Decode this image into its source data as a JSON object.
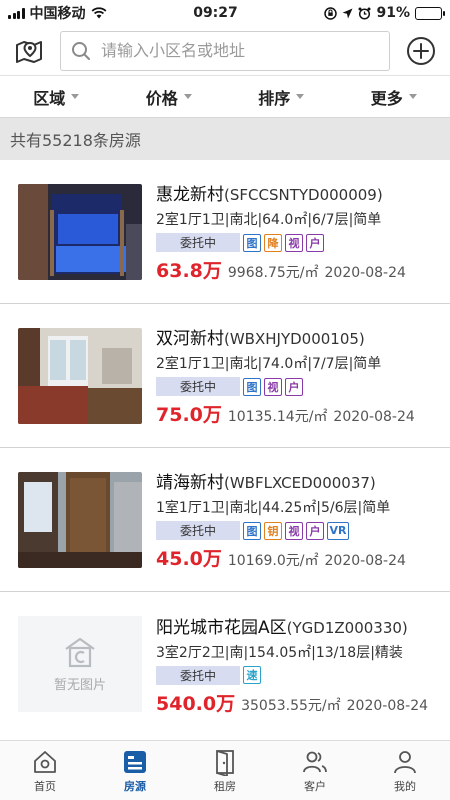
{
  "status_bar": {
    "carrier": "中国移动",
    "time": "09:27",
    "battery": "91%",
    "battery_level": 0.91
  },
  "search": {
    "placeholder": "请输入小区名或地址",
    "left_icon": "map-icon",
    "right_icon": "add-icon"
  },
  "filters": [
    {
      "label": "区域"
    },
    {
      "label": "价格"
    },
    {
      "label": "排序"
    },
    {
      "label": "更多"
    }
  ],
  "count_text": "共有55218条房源",
  "listings": [
    {
      "name": "惠龙新村",
      "code": "(SFCCSNTYD000009)",
      "specs": "2室1厅1卫|南北|64.0㎡|6/7层|简单",
      "status": "委托中",
      "tags": [
        {
          "text": "图",
          "color": "blue"
        },
        {
          "text": "降",
          "color": "orange"
        },
        {
          "text": "视",
          "color": "purple"
        },
        {
          "text": "户",
          "color": "purple"
        }
      ],
      "price": "63.8万",
      "unit_price": "9968.75元/㎡",
      "date": "2020-08-24",
      "has_photo": true
    },
    {
      "name": "双河新村",
      "code": "(WBXHJYD000105)",
      "specs": "2室1厅1卫|南北|74.0㎡|7/7层|简单",
      "status": "委托中",
      "tags": [
        {
          "text": "图",
          "color": "blue"
        },
        {
          "text": "视",
          "color": "purple"
        },
        {
          "text": "户",
          "color": "purple"
        }
      ],
      "price": "75.0万",
      "unit_price": "10135.14元/㎡",
      "date": "2020-08-24",
      "has_photo": true
    },
    {
      "name": "靖海新村",
      "code": "(WBFLXCED000037)",
      "specs": "1室1厅1卫|南北|44.25㎡|5/6层|简单",
      "status": "委托中",
      "tags": [
        {
          "text": "图",
          "color": "blue"
        },
        {
          "text": "钥",
          "color": "orange"
        },
        {
          "text": "视",
          "color": "purple"
        },
        {
          "text": "户",
          "color": "purple"
        },
        {
          "text": "VR",
          "color": "blue"
        }
      ],
      "price": "45.0万",
      "unit_price": "10169.0元/㎡",
      "date": "2020-08-24",
      "has_photo": true
    },
    {
      "name": "阳光城市花园A区",
      "code": "(YGD1Z000330)",
      "specs": "3室2厅2卫|南|154.05㎡|13/18层|精装",
      "status": "委托中",
      "tags": [
        {
          "text": "速",
          "color": "teal"
        }
      ],
      "price": "540.0万",
      "unit_price": "35053.55元/㎡",
      "date": "2020-08-24",
      "has_photo": false,
      "no_photo_text": "暂无图片"
    }
  ],
  "tabbar": [
    {
      "label": "首页",
      "icon": "home-icon",
      "active": false
    },
    {
      "label": "房源",
      "icon": "listings-icon",
      "active": true
    },
    {
      "label": "租房",
      "icon": "door-icon",
      "active": false
    },
    {
      "label": "客户",
      "icon": "customers-icon",
      "active": false
    },
    {
      "label": "我的",
      "icon": "profile-icon",
      "active": false
    }
  ],
  "colors": {
    "accent": "#1a5ea8",
    "price_red": "#e0242c",
    "count_bg": "#e6e6e6"
  }
}
